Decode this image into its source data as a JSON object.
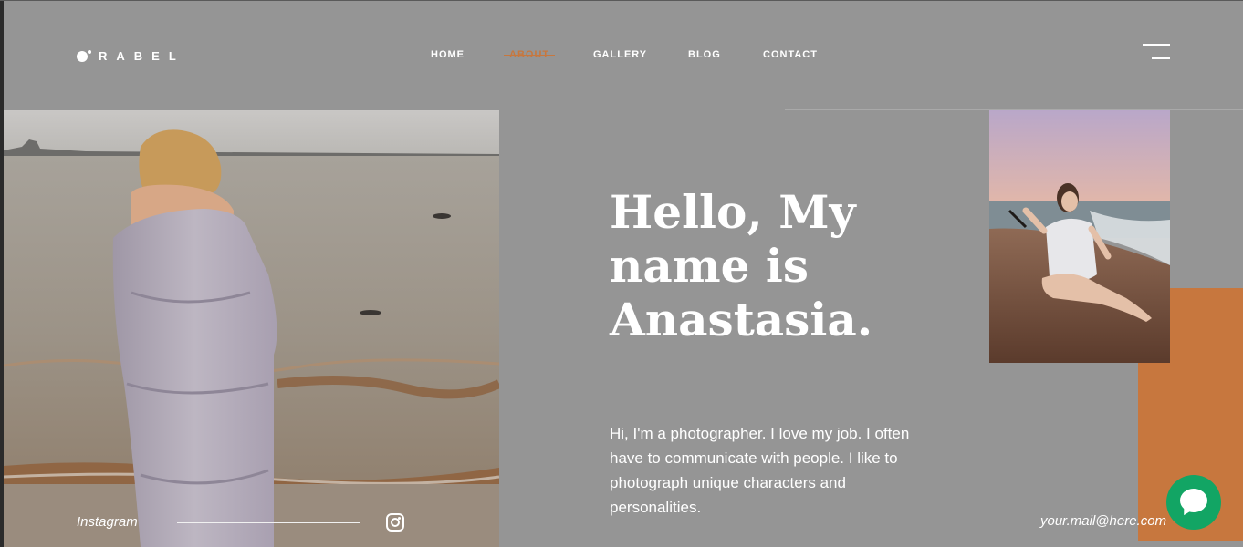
{
  "header": {
    "logo_text": "RABEL",
    "nav": [
      "HOME",
      "ABOUT",
      "GALLERY",
      "BLOG",
      "CONTACT"
    ],
    "active_nav": "ABOUT",
    "menu_icon": "hamburger-menu-icon"
  },
  "hero": {
    "headline": "Hello, My name is Anastasia.",
    "intro": "Hi, I'm a photographer. I love my job. I often have to communicate with people. I like to photograph unique characters and personalities."
  },
  "social": {
    "label": "Instagram",
    "icon": "instagram-icon"
  },
  "contact": {
    "email": "your.mail@here.com",
    "chat_icon": "chat-bubble-icon"
  },
  "colors": {
    "background": "#959595",
    "accent": "#c7773e",
    "chat": "#12a564",
    "text": "#ffffff"
  }
}
